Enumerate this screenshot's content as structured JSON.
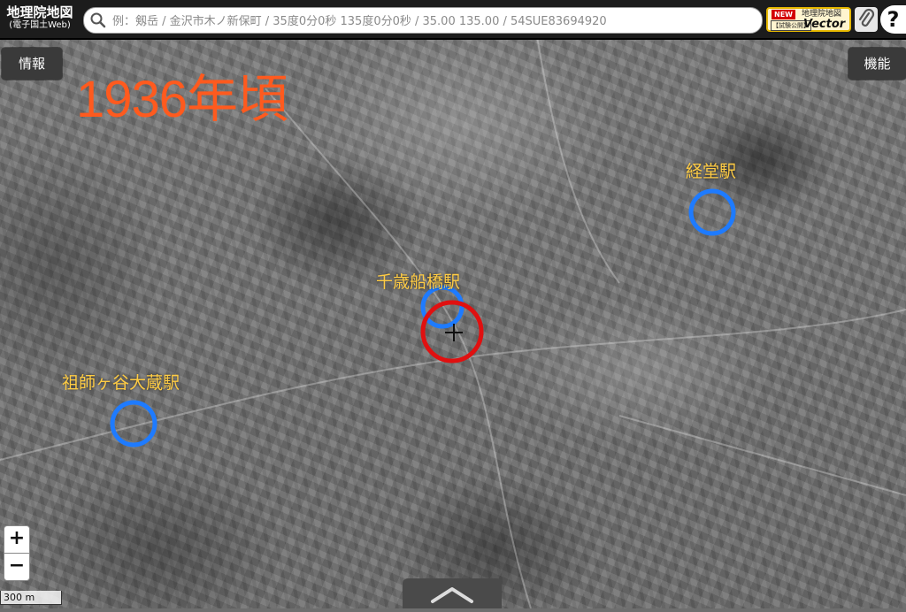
{
  "header": {
    "logo_main": "地理院地図",
    "logo_sub": "(電子国土Web)",
    "search_placeholder": "例：剱岳 / 金沢市木ノ新保町 / 35度0分0秒 135度0分0秒 / 35.00 135.00 / 54SUE83694920",
    "vector_new": "NEW",
    "vector_title": "地理院地図",
    "vector_note": "【試験公開】",
    "vector_word": "Vector",
    "help_label": "?"
  },
  "panel": {
    "info_label": "情報",
    "function_label": "機能"
  },
  "annotations": {
    "year": "1936年頃",
    "stations": [
      "経堂駅",
      "千歳船橋駅",
      "祖師ヶ谷大蔵駅"
    ]
  },
  "controls": {
    "zoom_in": "+",
    "zoom_out": "−",
    "scale_label": "300 m"
  },
  "colors": {
    "year_text": "#ff5a1e",
    "station_text": "#ffcc44",
    "station_circle": "#1e7bff",
    "center_circle": "#e01010"
  },
  "icons": [
    "search-icon",
    "paperclip-icon",
    "help-icon",
    "crosshair-icon",
    "chevron-up-icon"
  ]
}
